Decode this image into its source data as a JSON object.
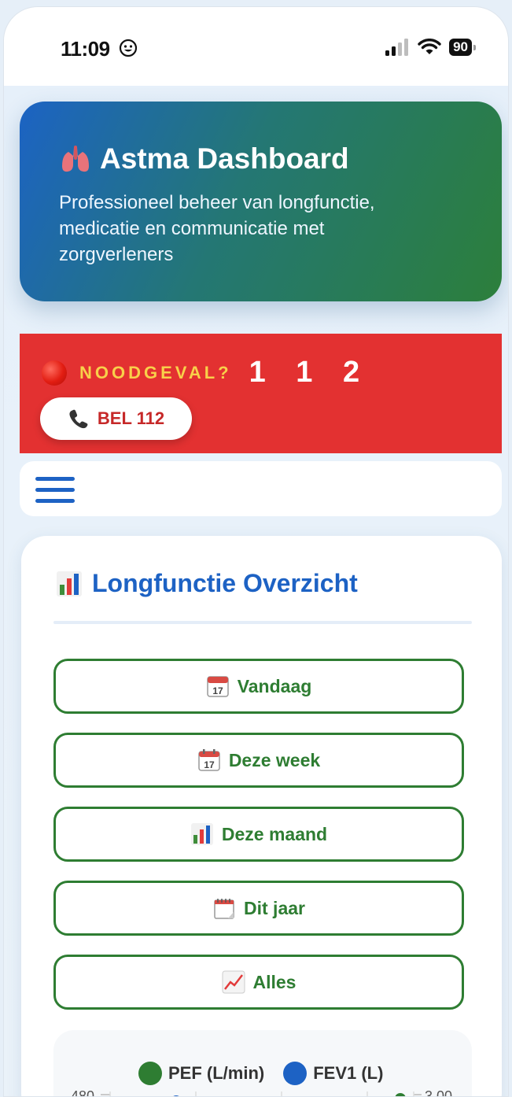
{
  "status_bar": {
    "time": "11:09",
    "battery": "90",
    "icons": [
      "smiley-icon",
      "signal-icon",
      "wifi-icon",
      "battery-icon"
    ]
  },
  "header": {
    "title": "Astma Dashboard",
    "description": "Professioneel beheer van longfunctie, medicatie en communicatie met zorgverleners",
    "icon": "lungs-icon"
  },
  "emergency": {
    "label": "NOODGEVAL?",
    "number": "1 1 2",
    "call_button": "BEL 112"
  },
  "nav": {
    "menu_icon": "hamburger-menu-icon"
  },
  "overview": {
    "title": "Longfunctie Overzicht",
    "periods": [
      {
        "label": "Vandaag",
        "icon": "calendar-icon"
      },
      {
        "label": "Deze week",
        "icon": "tear-off-calendar-icon"
      },
      {
        "label": "Deze maand",
        "icon": "bar-chart-icon"
      },
      {
        "label": "Dit jaar",
        "icon": "spiral-calendar-icon"
      },
      {
        "label": "Alles",
        "icon": "chart-increasing-icon"
      }
    ]
  },
  "colors": {
    "primary_blue": "#1d62c4",
    "green": "#2e7d32",
    "emergency_red": "#e33131",
    "emergency_label": "#f8d04a"
  },
  "chart_data": {
    "type": "line",
    "series": [
      {
        "name": "PEF (L/min)",
        "color": "#2e7d32",
        "axis": "left"
      },
      {
        "name": "FEV1 (L)",
        "color": "#1d62c4",
        "axis": "right"
      }
    ],
    "y_left_ticks": [
      "480"
    ],
    "y_right_ticks": [
      "3,00"
    ]
  }
}
